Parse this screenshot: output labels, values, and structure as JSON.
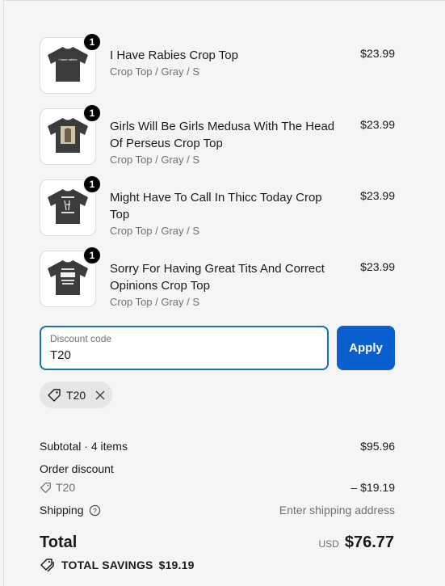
{
  "items": [
    {
      "quantity": "1",
      "title": "I Have Rabies Crop Top",
      "variant": "Crop Top / Gray / S",
      "price": "$23.99",
      "shirt_text": "i have rabies"
    },
    {
      "quantity": "1",
      "title": "Girls Will Be Girls Medusa With The Head Of Perseus Crop Top",
      "variant": "Crop Top / Gray / S",
      "price": "$23.99"
    },
    {
      "quantity": "1",
      "title": "Might Have To Call In Thicc Today Crop Top",
      "variant": "Crop Top / Gray / S",
      "price": "$23.99"
    },
    {
      "quantity": "1",
      "title": "Sorry For Having Great Tits And Correct Opinions Crop Top",
      "variant": "Crop Top / Gray / S",
      "price": "$23.99"
    }
  ],
  "discount": {
    "label": "Discount code",
    "value": "T20",
    "apply_label": "Apply",
    "applied_code": "T20"
  },
  "summary": {
    "subtotal_label": "Subtotal · 4 items",
    "subtotal_value": "$95.96",
    "order_discount_label": "Order discount",
    "order_discount_code": "T20",
    "order_discount_value": "– $19.19",
    "shipping_label": "Shipping",
    "shipping_value": "Enter shipping address",
    "total_label": "Total",
    "currency": "USD",
    "total_value": "$76.77",
    "savings_label": "TOTAL SAVINGS",
    "savings_value": "$19.19"
  },
  "colors": {
    "accent": "#0a5fce",
    "focus_border": "#1773b0",
    "shirt": "#3c3c3c"
  }
}
